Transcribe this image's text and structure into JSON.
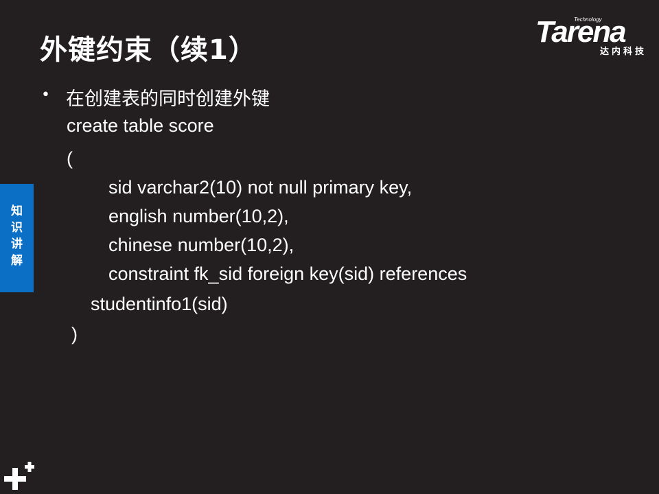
{
  "slide": {
    "title": "外键约束（续1）",
    "bullet": "在创建表的同时创建外键",
    "code_lines": [
      "create table score",
      "(",
      "sid varchar2(10) not null primary key,",
      "english number(10,2),",
      "chinese number(10,2),",
      "constraint fk_sid foreign key(sid) references",
      "studentinfo1(sid)",
      ")"
    ]
  },
  "logo": {
    "tagline": "Technology",
    "wordmark": "Tarena",
    "chinese_name": "达内科技"
  },
  "side_tab": {
    "label": "知识讲解"
  },
  "colors": {
    "background": "#231f20",
    "accent_blue": "#0b6fc6",
    "text": "#ffffff"
  },
  "icons": {
    "bottom_left": "plus-plus-icon",
    "bullet": "bullet-dot-icon"
  }
}
